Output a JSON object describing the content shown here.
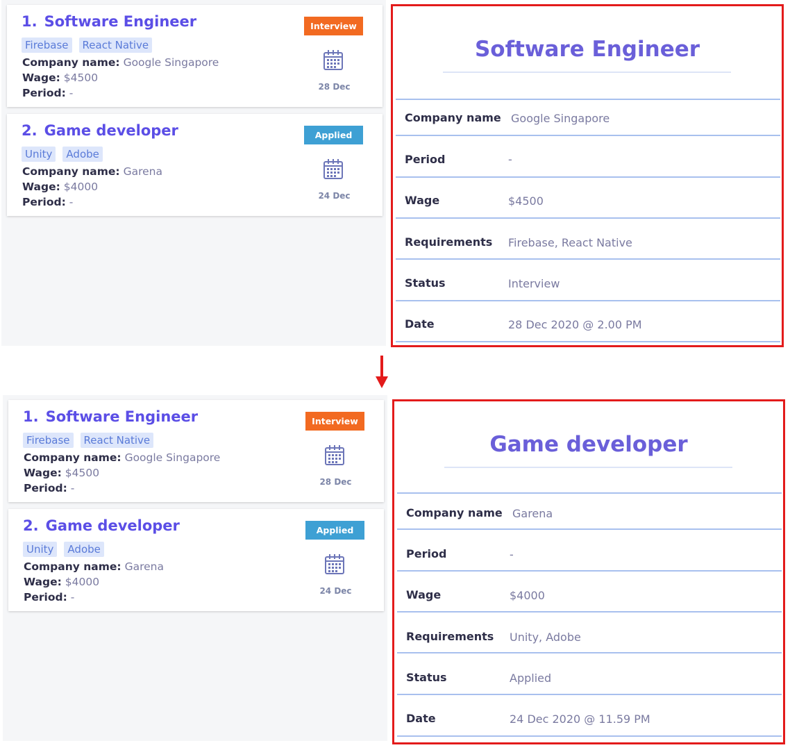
{
  "colors": {
    "interview_badge": "#f26a21",
    "applied_badge": "#3ea0d4",
    "accent_title": "#5b4ee6",
    "highlight_border": "#e31b1b",
    "arrow": "#e31b1b"
  },
  "icons": {
    "calendar": "calendar-icon",
    "arrow": "arrow-down-icon"
  },
  "field_labels": {
    "company": "Company name:",
    "wage": "Wage:",
    "period": "Period:"
  },
  "detail_labels": {
    "company": "Company name",
    "period": "Period",
    "wage": "Wage",
    "requirements": "Requirements",
    "status": "Status",
    "date": "Date"
  },
  "cards": [
    {
      "index": "1.",
      "title": "Software Engineer",
      "tags": [
        "Firebase",
        "React Native"
      ],
      "company": "Google Singapore",
      "wage": "$4500",
      "period": "-",
      "status": "Interview",
      "date_short": "28 Dec"
    },
    {
      "index": "2.",
      "title": "Game developer",
      "tags": [
        "Unity",
        "Adobe"
      ],
      "company": "Garena",
      "wage": "$4000",
      "period": "-",
      "status": "Applied",
      "date_short": "24 Dec"
    }
  ],
  "panels": [
    {
      "detail": {
        "title": "Software Engineer",
        "company": "Google Singapore",
        "period": "-",
        "wage": "$4500",
        "requirements": "Firebase, React Native",
        "status": "Interview",
        "date": "28 Dec 2020 @ 2.00 PM"
      }
    },
    {
      "detail": {
        "title": "Game developer",
        "company": "Garena",
        "period": "-",
        "wage": "$4000",
        "requirements": "Unity, Adobe",
        "status": "Applied",
        "date": "24 Dec 2020 @ 11.59 PM"
      }
    }
  ]
}
